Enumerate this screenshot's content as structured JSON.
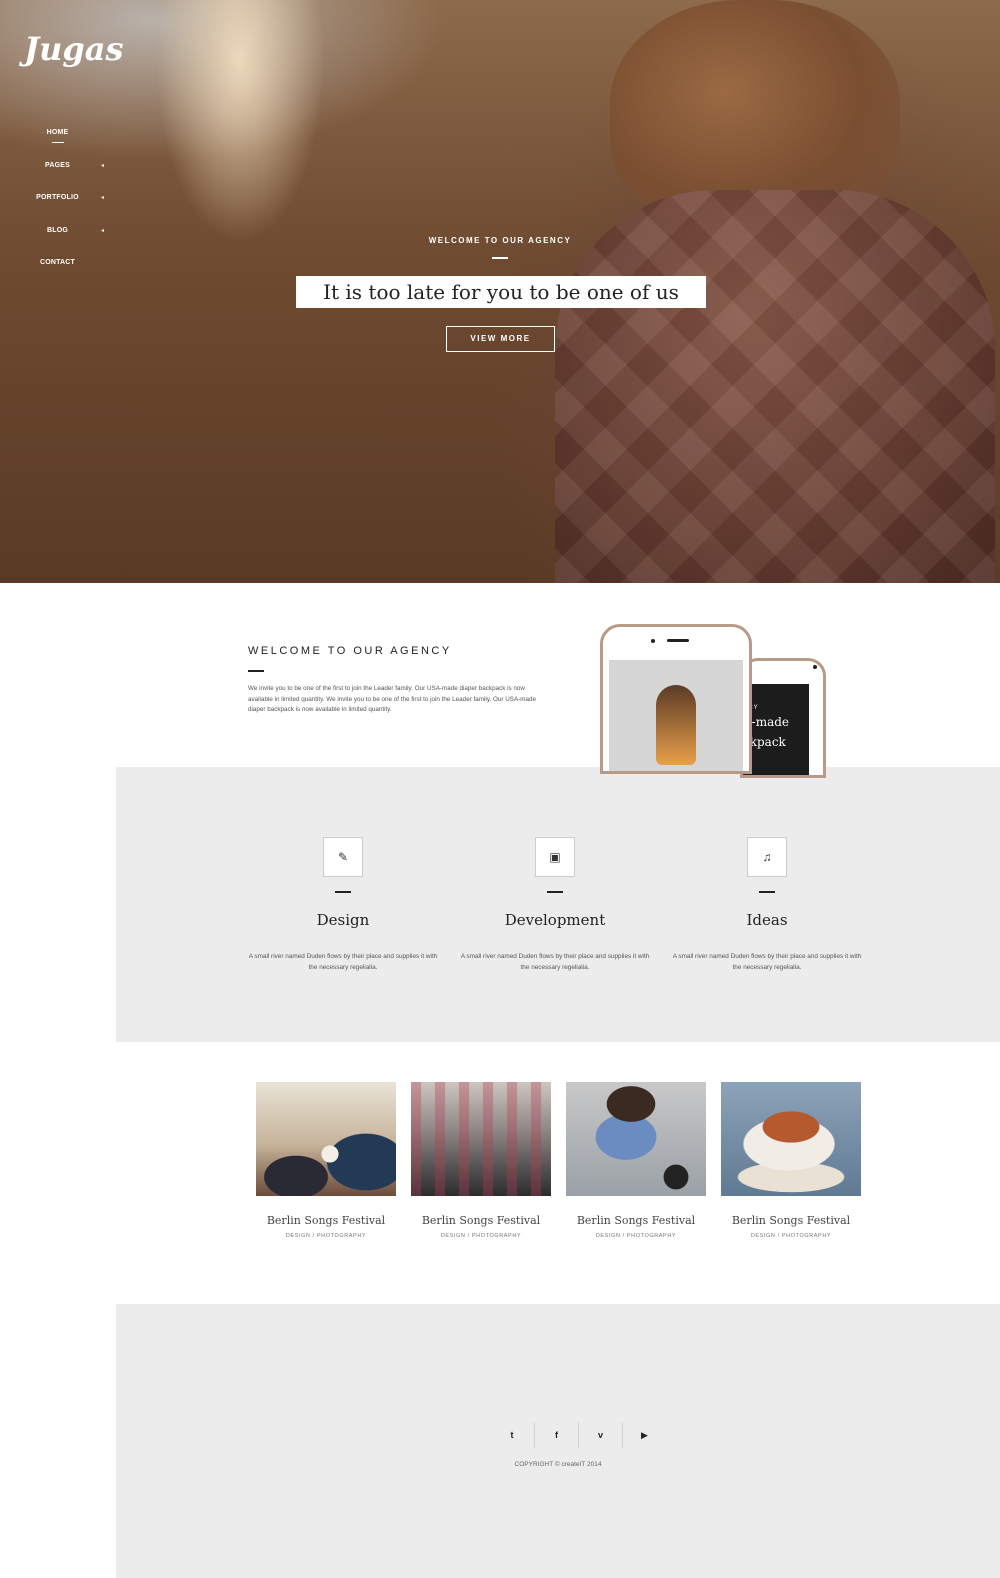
{
  "brand": {
    "logo": "Jugas"
  },
  "nav": {
    "items": [
      {
        "label": "HOME",
        "caret": "",
        "active": true
      },
      {
        "label": "PAGES",
        "caret": "◂"
      },
      {
        "label": "PORTFOLIO",
        "caret": "◂"
      },
      {
        "label": "BLOG",
        "caret": "◂"
      },
      {
        "label": "CONTACT",
        "caret": ""
      }
    ]
  },
  "hero": {
    "eyebrow": "WELCOME TO OUR AGENCY",
    "title": "It is too late for you to be one of us",
    "button": "VIEW MORE"
  },
  "about": {
    "title": "WELCOME TO OUR AGENCY",
    "text": "We invite you to be one of the first to join the Leader family. Our USA-made diaper backpack is now available in limited quantity. We invite you to be one of the first to join the Leader family. Our USA-made diaper backpack is now available in limited quantity.",
    "phone_back_small": "NCY",
    "phone_back_line1": "A-made",
    "phone_back_line2": "ckpack"
  },
  "services": [
    {
      "icon": "✎",
      "icon_name": "pencil-icon",
      "name": "Design",
      "desc": "A small river named Duden flows by their place and supplies it with the necessary regelialia."
    },
    {
      "icon": "▣",
      "icon_name": "image-icon",
      "name": "Development",
      "desc": "A small river named Duden flows by their place and supplies it with the necessary regelialia."
    },
    {
      "icon": "♫",
      "icon_name": "music-icon",
      "name": "Ideas",
      "desc": "A small river named Duden flows by their place and supplies it with the necessary regelialia."
    }
  ],
  "portfolio": [
    {
      "title": "Berlin Songs Festival",
      "cats": "DESIGN / PHOTOGRAPHY"
    },
    {
      "title": "Berlin Songs Festival",
      "cats": "DESIGN / PHOTOGRAPHY"
    },
    {
      "title": "Berlin Songs Festival",
      "cats": "DESIGN / PHOTOGRAPHY"
    },
    {
      "title": "Berlin Songs Festival",
      "cats": "DESIGN / PHOTOGRAPHY"
    }
  ],
  "footer": {
    "social": [
      {
        "glyph": "t",
        "name": "twitter-icon"
      },
      {
        "glyph": "f",
        "name": "facebook-icon"
      },
      {
        "glyph": "v",
        "name": "vimeo-icon"
      },
      {
        "glyph": "▶",
        "name": "youtube-icon"
      }
    ],
    "copyright": "COPYRIGHT © createIT 2014"
  }
}
